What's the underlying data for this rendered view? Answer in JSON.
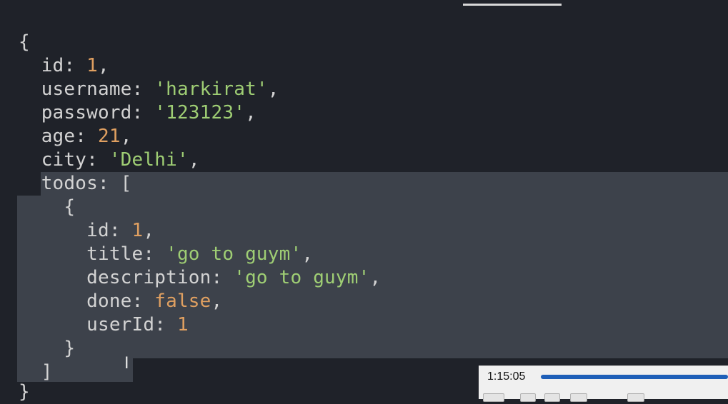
{
  "code": {
    "lines": [
      "{",
      "  id: 1,",
      "  username: 'harkirat',",
      "  password: '123123',",
      "  age: 21,",
      "  city: 'Delhi',",
      "  todos: [",
      "    {",
      "      id: 1,",
      "      title: 'go to guym',",
      "      description: 'go to guym',",
      "      done: false,",
      "      userId: 1",
      "    }",
      "  ]",
      "}"
    ]
  },
  "player": {
    "time": "1:15:05",
    "progress": 1.0
  },
  "colors": {
    "background": "#1f2229",
    "selection": "#3d424b",
    "number": "#e0a061",
    "string": "#9fce74",
    "key": "#d3d3d3"
  },
  "icons": [
    "text-cursor-icon"
  ]
}
